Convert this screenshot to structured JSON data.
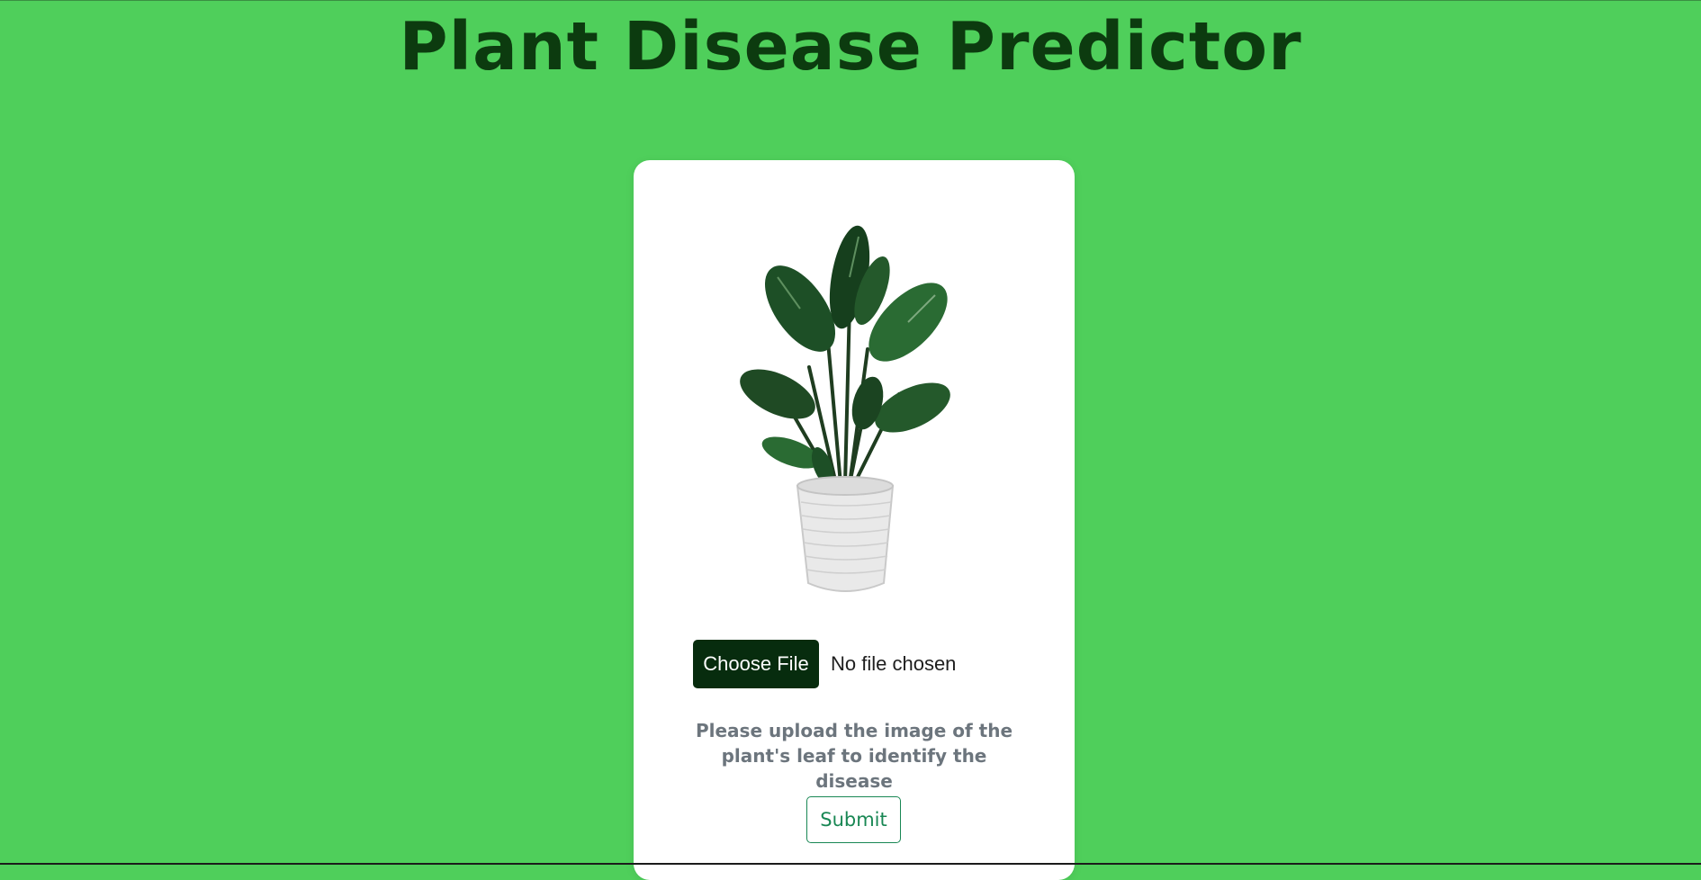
{
  "page": {
    "title": "Plant Disease Predictor",
    "background_color": "#4fcf5b",
    "title_color": "#0c3b0f"
  },
  "upload_card": {
    "image_icon": "potted-plant-image",
    "file_input": {
      "button_label": "Choose File",
      "status_text": "No file chosen"
    },
    "hint_text": "Please upload the image of the plant's leaf to identify the disease",
    "submit_label": "Submit",
    "accent_color": "#198754"
  }
}
